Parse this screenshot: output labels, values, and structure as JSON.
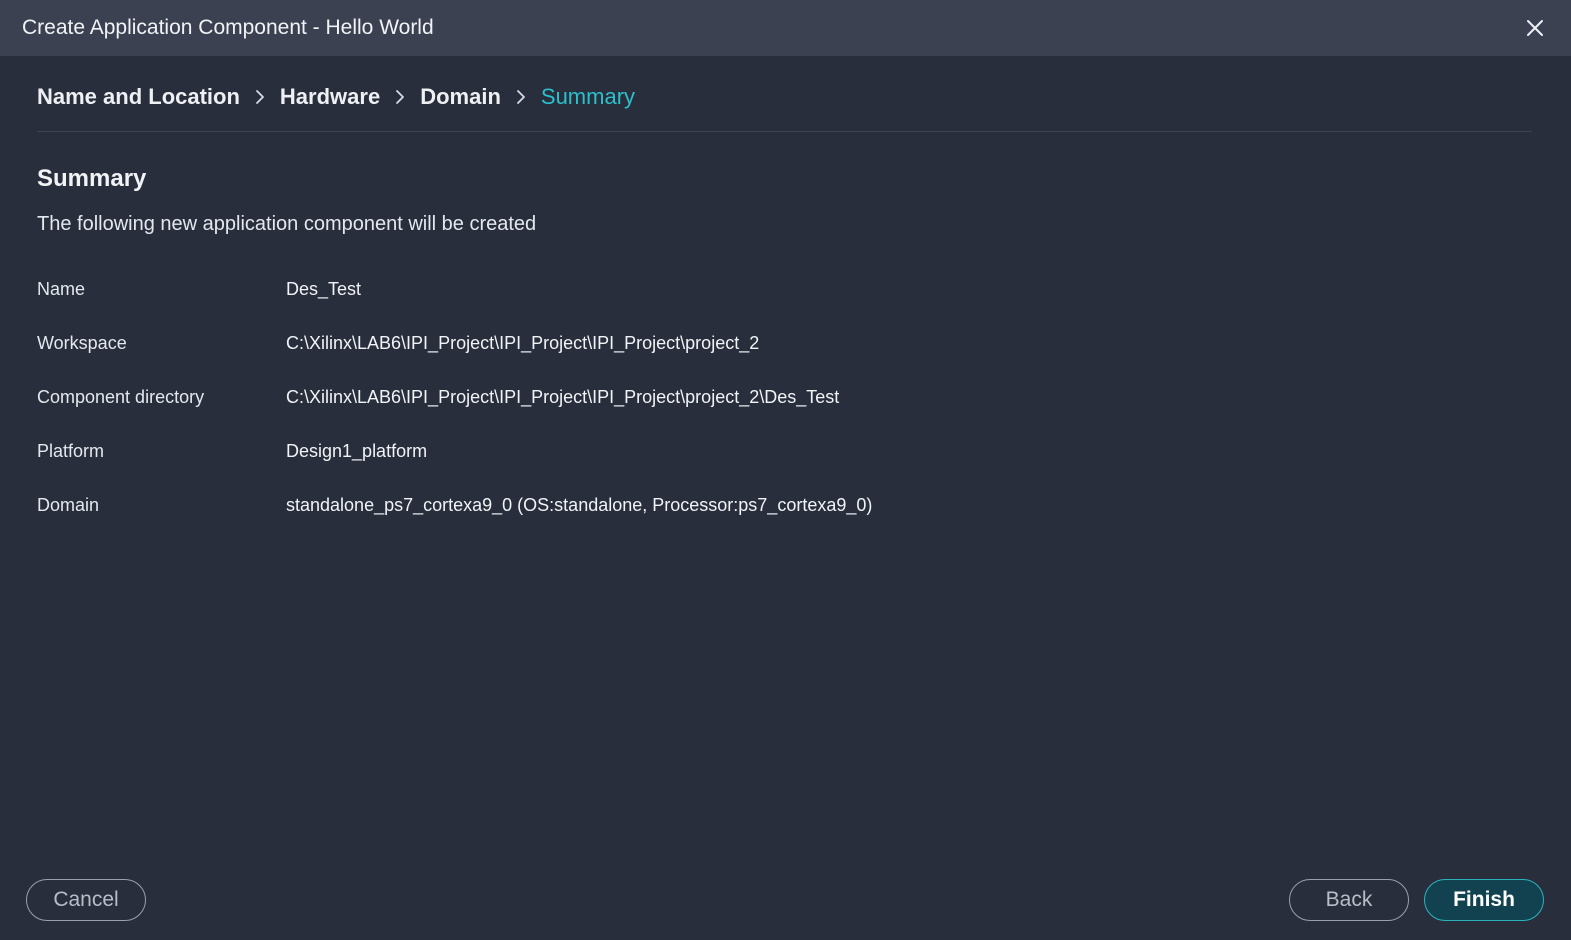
{
  "window": {
    "title": "Create Application Component - Hello World"
  },
  "breadcrumb": {
    "steps": [
      {
        "label": "Name and Location"
      },
      {
        "label": "Hardware"
      },
      {
        "label": "Domain"
      },
      {
        "label": "Summary"
      }
    ]
  },
  "summary": {
    "title": "Summary",
    "subtitle": "The following new application component will be created",
    "rows": [
      {
        "label": "Name",
        "value": "Des_Test"
      },
      {
        "label": "Workspace",
        "value": "C:\\Xilinx\\LAB6\\IPI_Project\\IPI_Project\\IPI_Project\\project_2"
      },
      {
        "label": "Component directory",
        "value": "C:\\Xilinx\\LAB6\\IPI_Project\\IPI_Project\\IPI_Project\\project_2\\Des_Test"
      },
      {
        "label": "Platform",
        "value": "Design1_platform"
      },
      {
        "label": "Domain",
        "value": "standalone_ps7_cortexa9_0 (OS:standalone, Processor:ps7_cortexa9_0)"
      }
    ]
  },
  "footer": {
    "cancel_label": "Cancel",
    "back_label": "Back",
    "finish_label": "Finish"
  },
  "colors": {
    "background": "#282e3b",
    "titlebar": "#3b4151",
    "accent": "#2bc0cc",
    "primary_button": "#12424f"
  },
  "icons": {
    "close": "close-icon",
    "separator": "chevron-right-icon"
  }
}
